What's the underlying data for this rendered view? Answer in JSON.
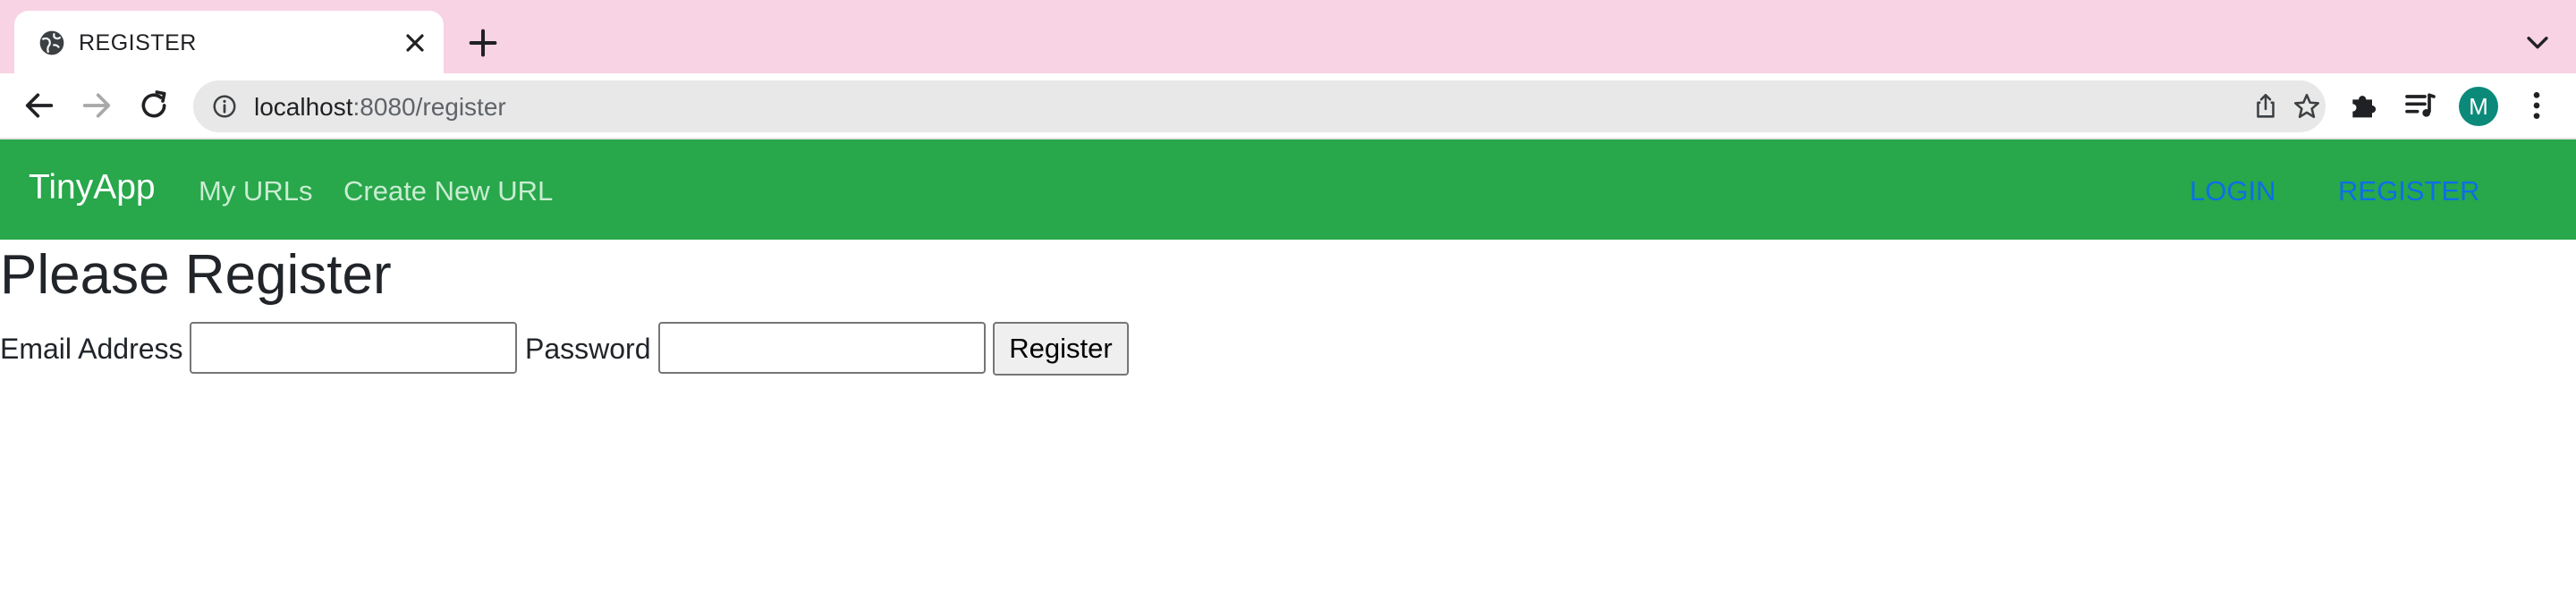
{
  "browser": {
    "tab": {
      "title": "REGISTER"
    },
    "address_bar": {
      "host": "localhost",
      "path": ":8080/register"
    },
    "profile_initial": "M"
  },
  "navbar": {
    "brand": "TinyApp",
    "links": [
      "My URLs",
      "Create New URL"
    ],
    "auth": {
      "login": "LOGIN",
      "register": "REGISTER"
    },
    "colors": {
      "background": "#28a74b",
      "auth_link": "#0b6fe8"
    }
  },
  "main": {
    "title": "Please Register",
    "form": {
      "email_label": "Email Address",
      "email_value": "",
      "password_label": "Password",
      "password_value": "",
      "submit_label": "Register"
    }
  },
  "icons": [
    "globe-icon",
    "close-icon",
    "plus-icon",
    "chevron-down-icon",
    "back-arrow-icon",
    "forward-arrow-icon",
    "reload-icon",
    "info-icon",
    "share-icon",
    "star-icon",
    "puzzle-icon",
    "reading-list-icon",
    "more-vert-icon"
  ]
}
